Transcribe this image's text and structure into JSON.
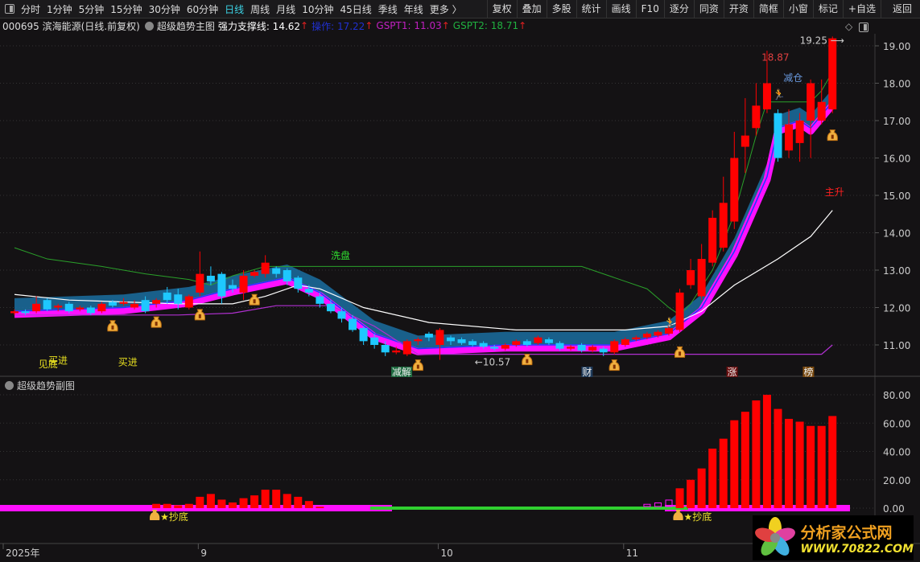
{
  "toolbar": {
    "periods": [
      "分时",
      "1分钟",
      "5分钟",
      "15分钟",
      "30分钟",
      "60分钟",
      "日线",
      "周线",
      "月线",
      "10分钟",
      "45日线",
      "季线",
      "年线",
      "更多 〉"
    ],
    "active_period": "日线",
    "buttons": [
      "复权",
      "叠加",
      "多股",
      "统计",
      "画线",
      "F10",
      "逐分",
      "同资",
      "开资",
      "简框",
      "小窗",
      "标记",
      "+自选",
      "返回"
    ]
  },
  "info": {
    "stock": "000695 滨海能源(日线.前复权)",
    "indicator": "超级趋势主图",
    "support_label": "强力支撑线: 14.62",
    "op_label": "操作: 17.22",
    "gspt1_label": "GSPT1: 11.03",
    "gspt2_label": "GSPT2: 18.71",
    "arrow": "↑"
  },
  "sub": {
    "title": "超级趋势副图"
  },
  "colors": {
    "up": "#ff0000",
    "down": "#1ec8ff",
    "green": "#2aa02a",
    "white": "#ffffff",
    "purple": "#b030d0",
    "magenta": "#ff10ff",
    "blue": "#1a3cff",
    "band": "#1a6fa0"
  },
  "chart_data": {
    "type": "candlestick",
    "price_axis": {
      "min": 10.5,
      "max": 19.5,
      "ticks": [
        "11.00",
        "12.00",
        "13.00",
        "14.00",
        "15.00",
        "16.00",
        "17.00",
        "18.00",
        "19.00"
      ]
    },
    "date_labels": [
      {
        "i": 0,
        "t": "2025年"
      },
      {
        "i": 17,
        "t": "9"
      },
      {
        "i": 39,
        "t": "10"
      },
      {
        "i": 56,
        "t": "11"
      }
    ],
    "candles": [
      [
        11.85,
        11.95,
        11.8,
        11.9
      ],
      [
        11.9,
        11.95,
        11.8,
        11.85
      ],
      [
        11.9,
        12.3,
        11.85,
        12.1
      ],
      [
        12.2,
        12.25,
        11.9,
        11.95
      ],
      [
        12.0,
        12.1,
        11.9,
        12.05
      ],
      [
        12.1,
        12.15,
        11.85,
        11.9
      ],
      [
        11.95,
        12.05,
        11.9,
        12.0
      ],
      [
        12.0,
        12.05,
        11.8,
        11.85
      ],
      [
        11.9,
        12.15,
        11.85,
        12.1
      ],
      [
        12.15,
        12.2,
        12.0,
        12.05
      ],
      [
        12.1,
        12.25,
        12.05,
        12.15
      ],
      [
        12.0,
        12.2,
        11.95,
        12.1
      ],
      [
        12.2,
        12.3,
        11.85,
        11.9
      ],
      [
        12.1,
        12.25,
        12.0,
        12.2
      ],
      [
        12.4,
        12.55,
        12.1,
        12.2
      ],
      [
        12.35,
        12.5,
        11.95,
        12.1
      ],
      [
        12.0,
        12.35,
        11.95,
        12.3
      ],
      [
        12.4,
        13.5,
        12.3,
        12.9
      ],
      [
        12.85,
        13.1,
        12.6,
        12.7
      ],
      [
        12.9,
        12.95,
        12.1,
        12.3
      ],
      [
        12.6,
        12.75,
        12.4,
        12.5
      ],
      [
        12.4,
        13.0,
        12.2,
        12.85
      ],
      [
        12.85,
        13.0,
        12.8,
        12.95
      ],
      [
        12.9,
        13.4,
        12.8,
        13.2
      ],
      [
        13.05,
        13.1,
        12.8,
        12.9
      ],
      [
        13.0,
        13.05,
        12.6,
        12.7
      ],
      [
        12.8,
        12.85,
        12.4,
        12.5
      ],
      [
        12.5,
        12.6,
        12.3,
        12.4
      ],
      [
        12.3,
        12.4,
        12.0,
        12.1
      ],
      [
        12.1,
        12.2,
        11.85,
        11.9
      ],
      [
        11.9,
        12.0,
        11.6,
        11.7
      ],
      [
        11.7,
        11.8,
        11.35,
        11.4
      ],
      [
        11.45,
        11.5,
        11.0,
        11.1
      ],
      [
        11.2,
        11.3,
        10.9,
        11.0
      ],
      [
        11.0,
        11.1,
        10.7,
        10.8
      ],
      [
        10.8,
        10.95,
        10.75,
        10.85
      ],
      [
        10.75,
        11.15,
        10.7,
        11.1
      ],
      [
        11.1,
        11.2,
        11.0,
        11.15
      ],
      [
        11.3,
        11.35,
        11.1,
        11.2
      ],
      [
        11.0,
        11.45,
        10.6,
        11.4
      ],
      [
        11.2,
        11.25,
        11.0,
        11.1
      ],
      [
        11.15,
        11.2,
        11.0,
        11.05
      ],
      [
        11.1,
        11.15,
        10.95,
        11.0
      ],
      [
        11.05,
        11.1,
        10.9,
        10.95
      ],
      [
        10.95,
        11.0,
        10.85,
        10.9
      ],
      [
        10.9,
        11.05,
        10.85,
        11.0
      ],
      [
        11.0,
        11.15,
        10.95,
        11.1
      ],
      [
        11.1,
        11.15,
        10.95,
        11.0
      ],
      [
        11.05,
        11.25,
        11.0,
        11.2
      ],
      [
        11.15,
        11.2,
        11.0,
        11.05
      ],
      [
        11.05,
        11.1,
        10.85,
        10.9
      ],
      [
        10.9,
        11.0,
        10.85,
        10.95
      ],
      [
        11.0,
        11.05,
        10.8,
        10.85
      ],
      [
        10.85,
        11.0,
        10.8,
        10.95
      ],
      [
        10.9,
        10.95,
        10.7,
        10.8
      ],
      [
        10.8,
        11.15,
        10.75,
        11.1
      ],
      [
        11.0,
        11.2,
        10.95,
        11.15
      ],
      [
        11.15,
        11.25,
        11.1,
        11.2
      ],
      [
        11.2,
        11.35,
        11.15,
        11.3
      ],
      [
        11.25,
        11.4,
        11.2,
        11.35
      ],
      [
        11.3,
        11.5,
        11.25,
        11.45
      ],
      [
        11.4,
        12.5,
        11.35,
        12.4
      ],
      [
        12.6,
        13.3,
        12.5,
        13.0
      ],
      [
        12.3,
        13.7,
        12.2,
        13.3
      ],
      [
        13.2,
        14.6,
        13.1,
        14.4
      ],
      [
        13.6,
        15.5,
        13.5,
        14.8
      ],
      [
        14.3,
        16.7,
        14.1,
        16.0
      ],
      [
        16.3,
        17.6,
        15.6,
        16.6
      ],
      [
        16.8,
        18.0,
        16.6,
        17.4
      ],
      [
        17.3,
        18.87,
        17.2,
        18.0
      ],
      [
        17.2,
        17.3,
        15.9,
        16.0
      ],
      [
        16.2,
        17.3,
        16.0,
        16.9
      ],
      [
        16.4,
        17.2,
        15.9,
        17.0
      ],
      [
        17.0,
        18.1,
        16.0,
        18.0
      ],
      [
        17.0,
        18.1,
        16.9,
        17.5
      ],
      [
        17.3,
        19.25,
        17.2,
        19.2
      ]
    ],
    "lines": {
      "green": [
        [
          0,
          13.6
        ],
        [
          3,
          13.3
        ],
        [
          8,
          13.1
        ],
        [
          12,
          12.9
        ],
        [
          16,
          12.75
        ],
        [
          18,
          12.6
        ],
        [
          20,
          12.85
        ],
        [
          23,
          13.1
        ],
        [
          52,
          13.1
        ],
        [
          56,
          12.7
        ],
        [
          58,
          12.5
        ],
        [
          60,
          12.0
        ],
        [
          61,
          11.8
        ],
        [
          62,
          12.1
        ],
        [
          64,
          13.0
        ],
        [
          66,
          14.5
        ],
        [
          68,
          16.6
        ],
        [
          69,
          17.5
        ],
        [
          73,
          17.5
        ],
        [
          74,
          17.8
        ],
        [
          75,
          18.3
        ]
      ],
      "white": [
        [
          0,
          12.35
        ],
        [
          5,
          12.2
        ],
        [
          15,
          12.1
        ],
        [
          20,
          12.1
        ],
        [
          23,
          12.3
        ],
        [
          26,
          12.6
        ],
        [
          28,
          12.5
        ],
        [
          32,
          12.0
        ],
        [
          38,
          11.6
        ],
        [
          46,
          11.4
        ],
        [
          56,
          11.4
        ],
        [
          60,
          11.5
        ],
        [
          63,
          11.9
        ],
        [
          66,
          12.6
        ],
        [
          70,
          13.3
        ],
        [
          73,
          13.9
        ],
        [
          75,
          14.6
        ]
      ],
      "purple": [
        [
          0,
          11.8
        ],
        [
          15,
          11.8
        ],
        [
          20,
          11.85
        ],
        [
          24,
          12.05
        ],
        [
          29,
          12.05
        ],
        [
          33,
          11.5
        ],
        [
          37,
          10.75
        ],
        [
          74,
          10.75
        ],
        [
          75,
          11.0
        ]
      ],
      "trend": [
        [
          0,
          11.9
        ],
        [
          10,
          12.0
        ],
        [
          16,
          12.2
        ],
        [
          20,
          12.5
        ],
        [
          25,
          12.8
        ],
        [
          28,
          12.4
        ],
        [
          33,
          11.3
        ],
        [
          37,
          10.9
        ],
        [
          45,
          11.0
        ],
        [
          55,
          11.0
        ],
        [
          60,
          11.3
        ],
        [
          63,
          12.0
        ],
        [
          66,
          13.5
        ],
        [
          69,
          15.5
        ],
        [
          70,
          16.8
        ],
        [
          72,
          17.0
        ],
        [
          73,
          16.8
        ],
        [
          75,
          17.5
        ]
      ]
    },
    "signals_bag": [
      [
        9,
        11.8
      ],
      [
        13,
        11.9
      ],
      [
        17,
        12.1
      ],
      [
        22,
        12.5
      ],
      [
        37,
        10.75
      ],
      [
        47,
        10.9
      ],
      [
        55,
        10.75
      ],
      [
        61,
        11.1
      ],
      [
        75,
        16.9
      ]
    ],
    "signals_run": [
      [
        60,
        11.5
      ],
      [
        70,
        17.6
      ]
    ],
    "annotations": [
      {
        "text": "洗盘",
        "i": 29,
        "p": 13.3,
        "color": "#30e030"
      },
      {
        "text": "减仓",
        "i": 70.5,
        "p": 18.05,
        "color": "#6a9ae0"
      },
      {
        "text": "18.87",
        "i": 68.5,
        "p": 18.6,
        "color": "#e04040"
      },
      {
        "text": "19.25 ⟶",
        "i": 72,
        "p": 19.05,
        "color": "#cccccc"
      },
      {
        "text": "主升",
        "i": 74.3,
        "p": 15.0,
        "color": "#ff2020"
      },
      {
        "text": "←10.57",
        "i": 42.2,
        "p": 10.45,
        "color": "#cccccc"
      },
      {
        "text": "见底",
        "i": 2.2,
        "p": 10.4,
        "color": "#e8e020"
      },
      {
        "text": "买进",
        "i": 3.1,
        "p": 10.5,
        "color": "#e8e020"
      },
      {
        "text": "买进",
        "i": 9.5,
        "p": 10.45,
        "color": "#e8e020"
      }
    ],
    "tags": [
      {
        "text": "减解",
        "i": 35.5,
        "bg": "#1e6a40"
      },
      {
        "text": "财",
        "i": 52.5,
        "bg": "#1e3a5a"
      },
      {
        "text": "涨",
        "i": 65.8,
        "bg": "#6a1010"
      },
      {
        "text": "榜",
        "i": 72.8,
        "bg": "#7a4a10"
      }
    ],
    "sub_chart": {
      "axis_ticks": [
        "0.00",
        "20.00",
        "40.00",
        "60.00",
        "80.00"
      ],
      "bars": [
        {
          "start": 13,
          "values": [
            3,
            3,
            2,
            3,
            8,
            10,
            6,
            4,
            7,
            9,
            13,
            13,
            10,
            8,
            5,
            1
          ]
        },
        {
          "start": 61,
          "values": [
            14,
            20,
            28,
            42,
            49,
            62,
            68,
            76,
            80,
            70,
            63,
            61,
            58,
            58,
            65
          ]
        }
      ],
      "small_bars": [
        {
          "i": 58,
          "v": 1
        },
        {
          "i": 59,
          "v": 2
        },
        {
          "i": 60,
          "v": 4
        }
      ],
      "signal_text": "★抄底",
      "signal_idx": [
        13,
        61
      ]
    }
  },
  "watermark": {
    "brand": "分析家公式网",
    "url": "WWW.70822.COM"
  }
}
